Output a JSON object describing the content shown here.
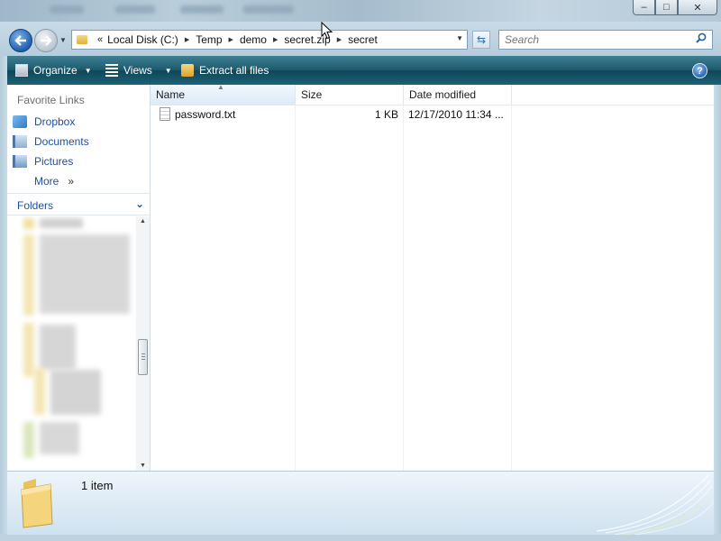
{
  "window": {
    "controls": {
      "minimize": "–",
      "maximize": "□",
      "close": "✕"
    }
  },
  "address_bar": {
    "overflow_chevron": "«",
    "crumbs": [
      "Local Disk (C:)",
      "Temp",
      "demo",
      "secret.zip",
      "secret"
    ]
  },
  "search": {
    "placeholder": "Search"
  },
  "toolbar": {
    "organize_label": "Organize",
    "views_label": "Views",
    "extract_label": "Extract all files",
    "help_label": "?"
  },
  "nav_pane": {
    "favorites_heading": "Favorite Links",
    "favorites": [
      {
        "label": "Dropbox",
        "icon": "dropbox-icon"
      },
      {
        "label": "Documents",
        "icon": "documents-icon"
      },
      {
        "label": "Pictures",
        "icon": "pictures-icon"
      }
    ],
    "more_label": "More",
    "more_chevron": "»",
    "folders_heading": "Folders"
  },
  "file_list": {
    "columns": [
      "Name",
      "Size",
      "Date modified"
    ],
    "sort_indicator": "▲",
    "rows": [
      {
        "name": "password.txt",
        "size": "1 KB",
        "date_modified": "12/17/2010 11:34 ..."
      }
    ]
  },
  "details_pane": {
    "item_count": "1 item"
  },
  "colors": {
    "command_bar": "#1d5a6e",
    "link_blue": "#1f4fa0"
  }
}
